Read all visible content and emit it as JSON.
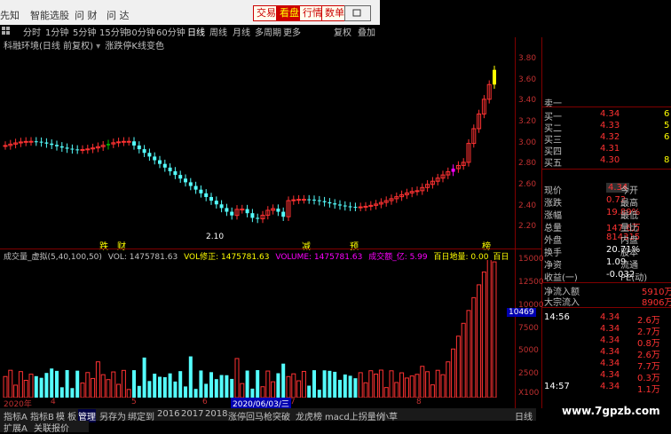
{
  "topbar": {
    "items": [
      "先知",
      "智能选股",
      "问 财",
      "问 达"
    ],
    "buttons": [
      "交易",
      "看盘",
      "行情",
      "数单",
      "resize"
    ]
  },
  "periodbar": {
    "items": [
      "分时",
      "1分钟",
      "5分钟",
      "15分钟",
      "30分钟",
      "60分钟",
      "日线",
      "周线",
      "月线",
      "多周期",
      "更多",
      "复权",
      "叠加",
      "统计",
      "画线",
      "F10",
      "标记",
      "+自选",
      "返回"
    ]
  },
  "title": {
    "main": "科融环境(日线 前复权)",
    "indicator": "涨跌停K线变色"
  },
  "price_axis": [
    "3.80",
    "3.60",
    "3.40",
    "3.20",
    "3.00",
    "2.80",
    "2.60",
    "2.40",
    "2.20"
  ],
  "price_low_label": "2.10",
  "markers": [
    {
      "text": "跌",
      "color": "#ffff00"
    },
    {
      "text": "财",
      "color": "#ffff00"
    },
    {
      "text": "减",
      "color": "#ffff00"
    },
    {
      "text": "预",
      "color": "#ffff00"
    },
    {
      "text": "榜",
      "color": "#ffff00"
    }
  ],
  "order_book": {
    "sell": [
      {
        "label": "卖一",
        "price": "",
        "vol": ""
      }
    ],
    "buy": [
      {
        "label": "买一",
        "price": "4.34",
        "vol": "6"
      },
      {
        "label": "买二",
        "price": "4.33",
        "vol": "5"
      },
      {
        "label": "买三",
        "price": "4.32",
        "vol": "6"
      },
      {
        "label": "买四",
        "price": "4.31",
        "vol": ""
      },
      {
        "label": "买五",
        "price": "4.30",
        "vol": "8"
      }
    ]
  },
  "stats": [
    {
      "l1": "现价",
      "v1": "4.34",
      "l2": "今开"
    },
    {
      "l1": "涨跌",
      "v1": "0.72",
      "l2": "最高"
    },
    {
      "l1": "涨幅",
      "v1": "19.89%",
      "l2": "最低"
    },
    {
      "l1": "总量",
      "v1": "147.6万",
      "l2": "量比"
    },
    {
      "l1": "外盘",
      "v1": "814315",
      "l2": "内盘"
    },
    {
      "l1": "换手",
      "v1": "20.71%",
      "l2": "股本"
    },
    {
      "l1": "净资",
      "v1": "1.09",
      "l2": "流通"
    },
    {
      "l1": "收益(一)",
      "v1": "-0.032",
      "l2": "PE(动)"
    }
  ],
  "flow": [
    {
      "label": "净流入额",
      "value": "5910万"
    },
    {
      "label": "大宗流入",
      "value": "8906万"
    }
  ],
  "ticks": [
    {
      "time": "14:56",
      "price": "4.34",
      "vol": "2.6万"
    },
    {
      "time": "",
      "price": "4.34",
      "vol": "2.7万"
    },
    {
      "time": "",
      "price": "4.34",
      "vol": "0.8万"
    },
    {
      "time": "",
      "price": "4.34",
      "vol": "2.6万"
    },
    {
      "time": "",
      "price": "4.34",
      "vol": "7.7万"
    },
    {
      "time": "",
      "price": "4.34",
      "vol": "0.3万"
    },
    {
      "time": "14:57",
      "price": "4.34",
      "vol": "1.1万"
    }
  ],
  "volume_header": {
    "name": "成交量_虚拟(5,40,100,50)",
    "vol_label": "VOL: 1475781.63",
    "vol_fix": "VOL修正: 1475781.63",
    "volume": "VOLUME: 1475781.63",
    "amount": "成交额_亿: 5.99",
    "baiday": "百日地量: 0.00",
    "extra": "百日"
  },
  "vol_axis": [
    "15000",
    "12500",
    "10000",
    "7500",
    "5000",
    "2500",
    "X100"
  ],
  "vol_current": "10469",
  "date_axis": [
    "2020年",
    "4",
    "5",
    "6",
    "2020/06/03/三",
    "7",
    "8"
  ],
  "bottombar": {
    "tabs": [
      "指标A",
      "指标B",
      "模 板",
      "管理",
      "另存为",
      "绑定到",
      "2016",
      "2017",
      "2018",
      "涨停回马枪",
      "突破",
      "龙虎榜",
      "macd上拐量价",
      "小草"
    ],
    "right": "日线"
  },
  "statusbar": [
    "扩展A",
    "关联报价"
  ],
  "watermark": "www.7gpzb.com",
  "chart_data": {
    "type": "candlestick",
    "price_ylim": [
      2.0,
      3.9
    ],
    "volume_ylim": [
      0,
      15000
    ],
    "colors": {
      "up": "#ff3232",
      "down": "#54fcfc",
      "limit_down": "#00c000",
      "limit_up": "#ffff00",
      "special": "#ff00ff"
    }
  }
}
